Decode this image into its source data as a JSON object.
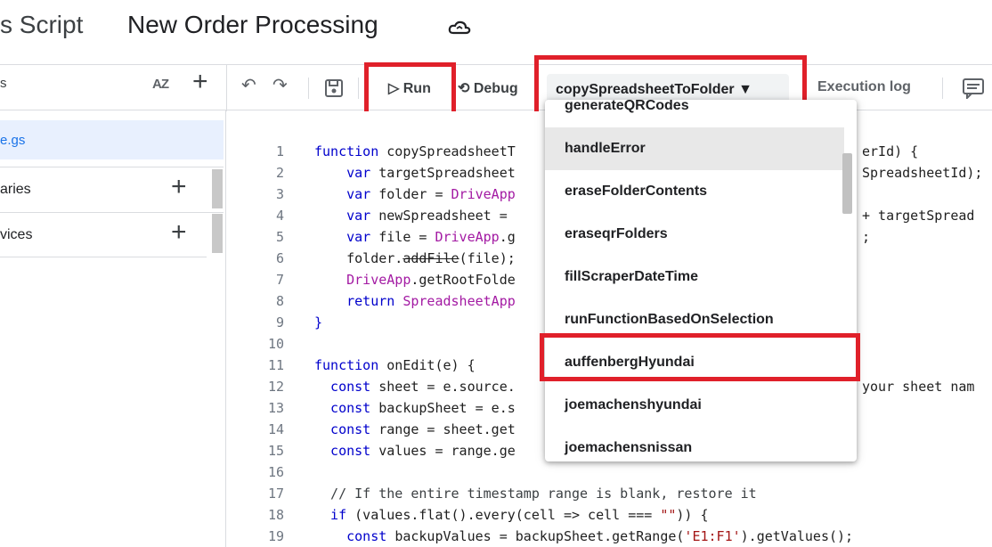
{
  "header": {
    "app_name": "s Script",
    "project_title": "New Order Processing",
    "cloud_icon": "cloud-sync-icon"
  },
  "toolbar": {
    "files_label": "s",
    "sort_icon": "AZ",
    "add_file": "+",
    "undo_icon": "↶",
    "redo_icon": "↷",
    "save_icon": "save-icon",
    "run_label": "▷ Run",
    "debug_label": "⟲ Debug",
    "function_selected": "copySpreadsheetToFolder",
    "execution_log_label": "Execution log"
  },
  "sidebar": {
    "active_file": "e.gs",
    "sections": [
      {
        "label": "aries",
        "add": "+"
      },
      {
        "label": "vices",
        "add": "+"
      }
    ]
  },
  "code_lines": [
    "1",
    "2",
    "3",
    "4",
    "5",
    "6",
    "7",
    "8",
    "9",
    "10",
    "11",
    "12",
    "13",
    "14",
    "15",
    "16",
    "17",
    "18",
    "19"
  ],
  "code": {
    "l1a": "function ",
    "l1b": "copySpreadsheetT",
    "l1c": "erId) {",
    "l2a": "    var ",
    "l2b": "targetSpreadsheet",
    "l2c": "SpreadsheetId);",
    "l3a": "    var ",
    "l3b": "folder = ",
    "l3c": "DriveApp",
    "l4a": "    var ",
    "l4b": "newSpreadsheet = ",
    "l4c": "+ targetSpread",
    "l5a": "    var ",
    "l5b": "file = ",
    "l5c": "DriveApp",
    "l5d": ".g",
    "l5e": ";",
    "l6a": "    folder.",
    "l6b": "addFile",
    "l6c": "(file);",
    "l7a": "    ",
    "l7b": "DriveApp",
    "l7c": ".getRootFolde",
    "l8a": "    return ",
    "l8b": "SpreadsheetApp",
    "l9": "}",
    "l11a": "function ",
    "l11b": "onEdit",
    "l11c": "(e) {",
    "l12a": "  const ",
    "l12b": "sheet = e.source.",
    "l12c": "your sheet nam",
    "l13a": "  const ",
    "l13b": "backupSheet = e.s",
    "l14a": "  const ",
    "l14b": "range = sheet.get",
    "l15a": "  const ",
    "l15b": "values = range.ge",
    "l17": "  // If the entire timestamp range is blank, restore it",
    "l18a": "  if ",
    "l18b": "(values.flat().every(cell => cell === ",
    "l18c": "\"\"",
    "l18d": ")) {",
    "l19a": "    const ",
    "l19b": "backupValues = backupSheet.getRange(",
    "l19c": "'E1:F1'",
    "l19d": ").getValues();"
  },
  "dropdown": {
    "items": [
      "generateQRCodes",
      "handleError",
      "eraseFolderContents",
      "eraseqrFolders",
      "fillScraperDateTime",
      "runFunctionBasedOnSelection",
      "auffenbergHyundai",
      "joemachenshyundai",
      "joemachensnissan"
    ],
    "hovered": "handleError",
    "highlighted": "auffenbergHyundai"
  },
  "colors": {
    "highlight_box": "#e0202a",
    "keyword": "#0000cc",
    "identifier_purple": "#a31aa3",
    "string": "#a31515",
    "active_file_bg": "#e8f0fe"
  }
}
